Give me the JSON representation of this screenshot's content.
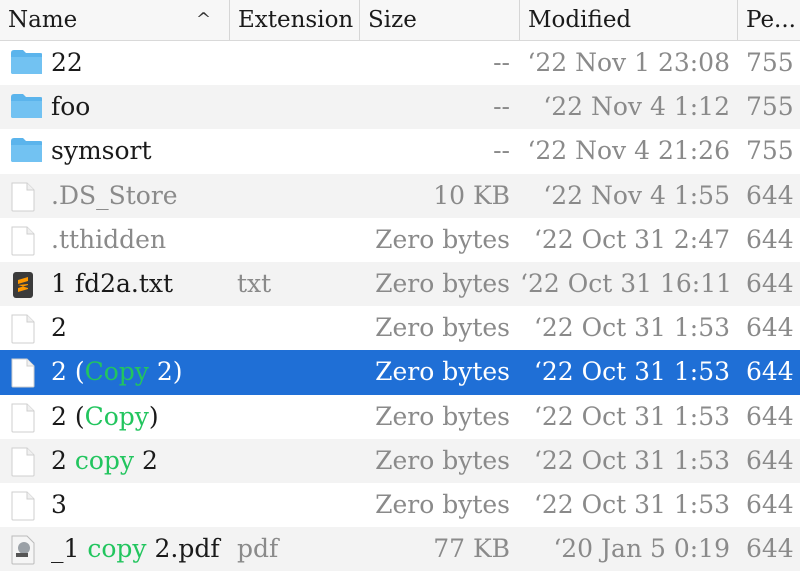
{
  "columns": {
    "name": "Name",
    "extension": "Extension",
    "size": "Size",
    "modified": "Modified",
    "permissions": "Pe..."
  },
  "sort_indicator": "^",
  "rows": [
    {
      "icon": "folder-icon",
      "name_pre": "22",
      "name_hl": "",
      "name_post": "",
      "ext": "",
      "size": "--",
      "modified": "‘22 Nov 1 23:08",
      "perm": "755"
    },
    {
      "icon": "folder-icon",
      "name_pre": "foo",
      "name_hl": "",
      "name_post": "",
      "ext": "",
      "size": "--",
      "modified": "‘22 Nov 4 1:12",
      "perm": "755"
    },
    {
      "icon": "folder-icon",
      "name_pre": "symsort",
      "name_hl": "",
      "name_post": "",
      "ext": "",
      "size": "--",
      "modified": "‘22 Nov 4 21:26",
      "perm": "755"
    },
    {
      "icon": "file-icon",
      "name_pre": ".DS_Store",
      "name_hl": "",
      "name_post": "",
      "ext": "",
      "size": "10 KB",
      "modified": "‘22 Nov 4 1:55",
      "perm": "644",
      "hidden": true
    },
    {
      "icon": "file-icon",
      "name_pre": ".tthidden",
      "name_hl": "",
      "name_post": "",
      "ext": "",
      "size": "Zero bytes",
      "modified": "‘22 Oct 31 2:47",
      "perm": "644",
      "hidden": true
    },
    {
      "icon": "sublime-text-icon",
      "name_pre": "1  fd2a.txt",
      "name_hl": "",
      "name_post": "",
      "ext": "txt",
      "size": "Zero bytes",
      "modified": "‘22 Oct 31 16:11",
      "perm": "644"
    },
    {
      "icon": "file-icon",
      "name_pre": "2",
      "name_hl": "",
      "name_post": "",
      "ext": "",
      "size": "Zero bytes",
      "modified": "‘22 Oct 31 1:53",
      "perm": "644"
    },
    {
      "icon": "file-icon",
      "name_pre": "2 (",
      "name_hl": "Copy",
      "name_post": " 2)",
      "ext": "",
      "size": "Zero bytes",
      "modified": "‘22 Oct 31 1:53",
      "perm": "644",
      "selected": true
    },
    {
      "icon": "file-icon",
      "name_pre": "2 (",
      "name_hl": "Copy",
      "name_post": ")",
      "ext": "",
      "size": "Zero bytes",
      "modified": "‘22 Oct 31 1:53",
      "perm": "644"
    },
    {
      "icon": "file-icon",
      "name_pre": "2 ",
      "name_hl": "copy",
      "name_post": " 2",
      "ext": "",
      "size": "Zero bytes",
      "modified": "‘22 Oct 31 1:53",
      "perm": "644"
    },
    {
      "icon": "file-icon",
      "name_pre": "3",
      "name_hl": "",
      "name_post": "",
      "ext": "",
      "size": "Zero bytes",
      "modified": "‘22 Oct 31 1:53",
      "perm": "644"
    },
    {
      "icon": "pdf-file-icon",
      "name_pre": "_1 ",
      "name_hl": "copy",
      "name_post": " 2.pdf",
      "ext": "pdf",
      "size": "77 KB",
      "modified": "‘20 Jan 5 0:19",
      "perm": "644"
    }
  ],
  "colors": {
    "selection": "#1f6fd6",
    "highlight": "#22c55e",
    "folder": "#5bb4ec"
  }
}
